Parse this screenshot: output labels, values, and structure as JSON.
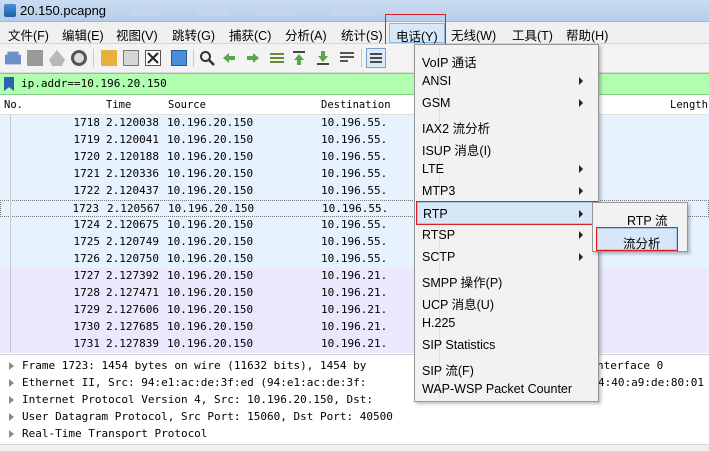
{
  "window": {
    "title": "20.150.pcapng"
  },
  "menubar": {
    "items": [
      "文件(F)",
      "编辑(E)",
      "视图(V)",
      "跳转(G)",
      "捕获(C)",
      "分析(A)",
      "统计(S)",
      "电话(Y)",
      "无线(W)",
      "工具(T)",
      "帮助(H)"
    ]
  },
  "filter": {
    "value": "ip.addr==10.196.20.150"
  },
  "columns": {
    "no": "No.",
    "time": "Time",
    "source": "Source",
    "destination": "Destination",
    "length": "Length"
  },
  "packets": [
    {
      "no": "1718",
      "time": "2.120038",
      "source": "10.196.20.150",
      "destination": "10.196.55."
    },
    {
      "no": "1719",
      "time": "2.120041",
      "source": "10.196.20.150",
      "destination": "10.196.55."
    },
    {
      "no": "1720",
      "time": "2.120188",
      "source": "10.196.20.150",
      "destination": "10.196.55."
    },
    {
      "no": "1721",
      "time": "2.120336",
      "source": "10.196.20.150",
      "destination": "10.196.55."
    },
    {
      "no": "1722",
      "time": "2.120437",
      "source": "10.196.20.150",
      "destination": "10.196.55."
    },
    {
      "no": "1723",
      "time": "2.120567",
      "source": "10.196.20.150",
      "destination": "10.196.55."
    },
    {
      "no": "1724",
      "time": "2.120675",
      "source": "10.196.20.150",
      "destination": "10.196.55."
    },
    {
      "no": "1725",
      "time": "2.120749",
      "source": "10.196.20.150",
      "destination": "10.196.55."
    },
    {
      "no": "1726",
      "time": "2.120750",
      "source": "10.196.20.150",
      "destination": "10.196.55."
    },
    {
      "no": "1727",
      "time": "2.127392",
      "source": "10.196.20.150",
      "destination": "10.196.21."
    },
    {
      "no": "1728",
      "time": "2.127471",
      "source": "10.196.20.150",
      "destination": "10.196.21."
    },
    {
      "no": "1729",
      "time": "2.127606",
      "source": "10.196.20.150",
      "destination": "10.196.21."
    },
    {
      "no": "1730",
      "time": "2.127685",
      "source": "10.196.20.150",
      "destination": "10.196.21."
    },
    {
      "no": "1731",
      "time": "2.127839",
      "source": "10.196.20.150",
      "destination": "10.196.21."
    }
  ],
  "details": [
    {
      "left": "Frame 1723: 1454 bytes on wire (11632 bits), 1454 by",
      "right": "nterface 0"
    },
    {
      "left": "Ethernet II, Src: 94:e1:ac:de:3f:ed (94:e1:ac:de:3f:",
      "right": "4:40:a9:de:80:01"
    },
    {
      "left": "Internet Protocol Version 4, Src: 10.196.20.150, Dst:",
      "right": ""
    },
    {
      "left": "User Datagram Protocol, Src Port: 15060, Dst Port: 40500",
      "right": ""
    },
    {
      "left": "Real-Time Transport Protocol",
      "right": ""
    }
  ],
  "telephony_menu": [
    {
      "label": "VoIP 通话",
      "submenu": false
    },
    {
      "label": "ANSI",
      "submenu": true
    },
    {
      "label": "GSM",
      "submenu": true
    },
    {
      "label": "IAX2 流分析",
      "submenu": false
    },
    {
      "label": "ISUP 消息(I)",
      "submenu": false
    },
    {
      "label": "LTE",
      "submenu": true
    },
    {
      "label": "MTP3",
      "submenu": true
    },
    {
      "label": "RTP",
      "submenu": true
    },
    {
      "label": "RTSP",
      "submenu": true
    },
    {
      "label": "SCTP",
      "submenu": true
    },
    {
      "label": "SMPP 操作(P)",
      "submenu": false
    },
    {
      "label": "UCP 消息(U)",
      "submenu": false
    },
    {
      "label": "H.225",
      "submenu": false
    },
    {
      "label": "SIP Statistics",
      "submenu": false
    },
    {
      "label": "SIP 流(F)",
      "submenu": false
    },
    {
      "label": "WAP-WSP Packet Counter",
      "submenu": false
    }
  ],
  "rtp_submenu": [
    {
      "label": "RTP 流"
    },
    {
      "label": "流分析"
    }
  ],
  "colors": {
    "filter_bg": "#afffaf",
    "row_blue": "#e7f2ff",
    "row_purple": "#ece7fc",
    "highlight_red": "#e02020"
  }
}
